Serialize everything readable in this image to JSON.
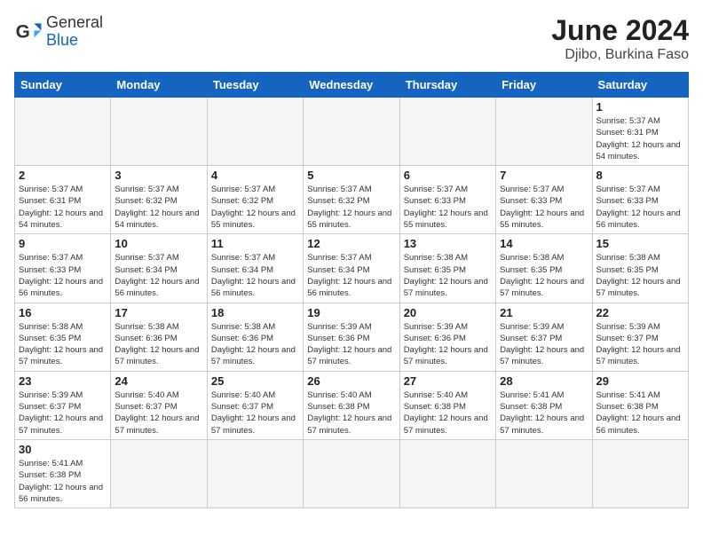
{
  "header": {
    "logo_general": "General",
    "logo_blue": "Blue",
    "title": "June 2024",
    "subtitle": "Djibo, Burkina Faso"
  },
  "days_of_week": [
    "Sunday",
    "Monday",
    "Tuesday",
    "Wednesday",
    "Thursday",
    "Friday",
    "Saturday"
  ],
  "weeks": [
    [
      {
        "day": "",
        "empty": true
      },
      {
        "day": "",
        "empty": true
      },
      {
        "day": "",
        "empty": true
      },
      {
        "day": "",
        "empty": true
      },
      {
        "day": "",
        "empty": true
      },
      {
        "day": "",
        "empty": true
      },
      {
        "day": "1",
        "sunrise": "5:37 AM",
        "sunset": "6:31 PM",
        "daylight": "12 hours and 54 minutes."
      }
    ],
    [
      {
        "day": "2",
        "sunrise": "5:37 AM",
        "sunset": "6:31 PM",
        "daylight": "12 hours and 54 minutes."
      },
      {
        "day": "3",
        "sunrise": "5:37 AM",
        "sunset": "6:32 PM",
        "daylight": "12 hours and 54 minutes."
      },
      {
        "day": "4",
        "sunrise": "5:37 AM",
        "sunset": "6:32 PM",
        "daylight": "12 hours and 55 minutes."
      },
      {
        "day": "5",
        "sunrise": "5:37 AM",
        "sunset": "6:32 PM",
        "daylight": "12 hours and 55 minutes."
      },
      {
        "day": "6",
        "sunrise": "5:37 AM",
        "sunset": "6:33 PM",
        "daylight": "12 hours and 55 minutes."
      },
      {
        "day": "7",
        "sunrise": "5:37 AM",
        "sunset": "6:33 PM",
        "daylight": "12 hours and 55 minutes."
      },
      {
        "day": "8",
        "sunrise": "5:37 AM",
        "sunset": "6:33 PM",
        "daylight": "12 hours and 56 minutes."
      }
    ],
    [
      {
        "day": "9",
        "sunrise": "5:37 AM",
        "sunset": "6:33 PM",
        "daylight": "12 hours and 56 minutes."
      },
      {
        "day": "10",
        "sunrise": "5:37 AM",
        "sunset": "6:34 PM",
        "daylight": "12 hours and 56 minutes."
      },
      {
        "day": "11",
        "sunrise": "5:37 AM",
        "sunset": "6:34 PM",
        "daylight": "12 hours and 56 minutes."
      },
      {
        "day": "12",
        "sunrise": "5:37 AM",
        "sunset": "6:34 PM",
        "daylight": "12 hours and 56 minutes."
      },
      {
        "day": "13",
        "sunrise": "5:38 AM",
        "sunset": "6:35 PM",
        "daylight": "12 hours and 57 minutes."
      },
      {
        "day": "14",
        "sunrise": "5:38 AM",
        "sunset": "6:35 PM",
        "daylight": "12 hours and 57 minutes."
      },
      {
        "day": "15",
        "sunrise": "5:38 AM",
        "sunset": "6:35 PM",
        "daylight": "12 hours and 57 minutes."
      }
    ],
    [
      {
        "day": "16",
        "sunrise": "5:38 AM",
        "sunset": "6:35 PM",
        "daylight": "12 hours and 57 minutes."
      },
      {
        "day": "17",
        "sunrise": "5:38 AM",
        "sunset": "6:36 PM",
        "daylight": "12 hours and 57 minutes."
      },
      {
        "day": "18",
        "sunrise": "5:38 AM",
        "sunset": "6:36 PM",
        "daylight": "12 hours and 57 minutes."
      },
      {
        "day": "19",
        "sunrise": "5:39 AM",
        "sunset": "6:36 PM",
        "daylight": "12 hours and 57 minutes."
      },
      {
        "day": "20",
        "sunrise": "5:39 AM",
        "sunset": "6:36 PM",
        "daylight": "12 hours and 57 minutes."
      },
      {
        "day": "21",
        "sunrise": "5:39 AM",
        "sunset": "6:37 PM",
        "daylight": "12 hours and 57 minutes."
      },
      {
        "day": "22",
        "sunrise": "5:39 AM",
        "sunset": "6:37 PM",
        "daylight": "12 hours and 57 minutes."
      }
    ],
    [
      {
        "day": "23",
        "sunrise": "5:39 AM",
        "sunset": "6:37 PM",
        "daylight": "12 hours and 57 minutes."
      },
      {
        "day": "24",
        "sunrise": "5:40 AM",
        "sunset": "6:37 PM",
        "daylight": "12 hours and 57 minutes."
      },
      {
        "day": "25",
        "sunrise": "5:40 AM",
        "sunset": "6:37 PM",
        "daylight": "12 hours and 57 minutes."
      },
      {
        "day": "26",
        "sunrise": "5:40 AM",
        "sunset": "6:38 PM",
        "daylight": "12 hours and 57 minutes."
      },
      {
        "day": "27",
        "sunrise": "5:40 AM",
        "sunset": "6:38 PM",
        "daylight": "12 hours and 57 minutes."
      },
      {
        "day": "28",
        "sunrise": "5:41 AM",
        "sunset": "6:38 PM",
        "daylight": "12 hours and 57 minutes."
      },
      {
        "day": "29",
        "sunrise": "5:41 AM",
        "sunset": "6:38 PM",
        "daylight": "12 hours and 56 minutes."
      }
    ],
    [
      {
        "day": "30",
        "sunrise": "5:41 AM",
        "sunset": "6:38 PM",
        "daylight": "12 hours and 56 minutes."
      },
      {
        "day": "",
        "empty": true
      },
      {
        "day": "",
        "empty": true
      },
      {
        "day": "",
        "empty": true
      },
      {
        "day": "",
        "empty": true
      },
      {
        "day": "",
        "empty": true
      },
      {
        "day": "",
        "empty": true
      }
    ]
  ],
  "labels": {
    "sunrise": "Sunrise:",
    "sunset": "Sunset:",
    "daylight": "Daylight:"
  }
}
